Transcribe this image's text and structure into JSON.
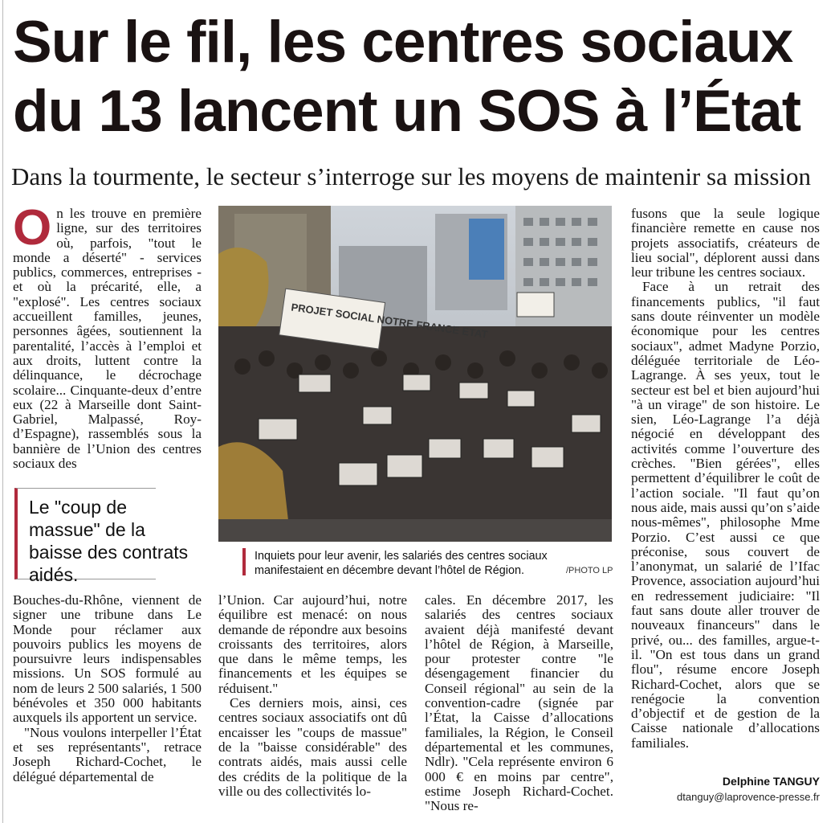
{
  "article": {
    "title_line1": "Sur le fil, les centres sociaux",
    "title_line2": "du 13 lancent un SOS à l’État",
    "subtitle": "Dans la tourmente, le secteur s’interroge sur les moyens de maintenir sa mission",
    "dropcap": "O",
    "col1_top": "n les trouve en première ligne, sur des territoires où, parfois, \"tout le monde a déserté\" - services publics, commerces, entreprises - et où la précarité, elle, a \"explosé\". Les centres sociaux accueillent familles, jeunes, personnes âgées, soutiennent la parentalité, l’accès à l’emploi et aux droits, luttent contre la délinquance, le décrochage scolaire... Cinquante-deux d’entre eux (22 à Marseille dont Saint-Gabriel, Malpassé, Roy-d’Espagne), rassemblés sous la bannière de l’Union des centres sociaux des",
    "pull_quote": "Le \"coup de massue\" de la baisse des contrats aidés.",
    "col1_bottom_p1": "Bouches-du-Rhône, viennent de signer une tribune dans Le Monde pour réclamer aux pouvoirs publics les moyens de poursuivre leurs indispensables missions. Un SOS formulé au nom de leurs 2 500 salariés, 1 500 bénévoles et 350 000 habitants auxquels ils apportent un service.",
    "col1_bottom_p2": "\"Nous voulons interpeller l’État et ses représentants\", retrace Joseph Richard-Cochet, le délégué départemental de",
    "col2_p1": "l’Union. Car aujourd’hui, notre équilibre est menacé: on nous demande de répondre aux besoins croissants des territoires, alors que dans le même temps, les financements et les équipes se réduisent.\"",
    "col2_p2": "Ces derniers mois, ainsi, ces centres sociaux associatifs ont dû encaisser les \"coups de massue\" de la \"baisse considérable\" des contrats aidés, mais aussi celle des crédits de la politique de la ville ou des collectivités lo-",
    "col3_text": "cales. En décembre 2017, les salariés des centres sociaux avaient déjà manifesté devant l’hôtel de Région, à Marseille, pour protester contre \"le désengagement financier du Conseil régional\" au sein de la convention-cadre (signée par l’État, la Caisse d’allocations familiales, la Région, le Conseil départemental et les communes, Ndlr). \"Cela représente environ 6 000 € en moins par centre\", estime Joseph Richard-Cochet. \"Nous re-",
    "col4_p1": "fusons que la seule logique financière remette en cause nos projets associatifs, créateurs de lieu social\", déplorent aussi dans leur tribune les centres sociaux.",
    "col4_p2": "Face à un retrait des financements publics, \"il faut sans doute réinventer un modèle économique pour les centres sociaux\", admet Madyne Porzio, déléguée territoriale de Léo-Lagrange. À ses yeux, tout le secteur est bel et bien aujourd’hui \"à un virage\" de son histoire. Le sien, Léo-Lagrange l’a déjà négocié en développant des activités comme l’ouverture des crèches. \"Bien gérées\", elles permettent d’équilibrer le coût de l’action sociale. \"Il faut qu’on nous aide, mais aussi qu’on s’aide nous-mêmes\", philosophe Mme Porzio. C’est aussi ce que préconise, sous couvert de l’anonymat, un salarié de l’Ifac Provence, association aujourd’hui en redressement judiciaire: \"Il faut sans doute aller trouver de nouveaux financeurs\" dans le privé, ou... des familles, argue-t-il. \"On est tous dans un grand flou\", résume encore Joseph Richard-Cochet, alors que se renégocie la convention d’objectif et de gestion de la Caisse nationale d’allocations familiales.",
    "caption": "Inquiets pour leur avenir, les salariés des centres sociaux manifestaient en décembre devant l’hôtel de Région.",
    "photo_credit": "/PHOTO LP",
    "author": "Delphine TANGUY",
    "email": "dtanguy@laprovence-presse.fr",
    "banner_text": "PROJET SOCIAL NOTRE FRANCE ETAT"
  },
  "colors": {
    "accent": "#b02a3c",
    "text": "#1a1212"
  }
}
